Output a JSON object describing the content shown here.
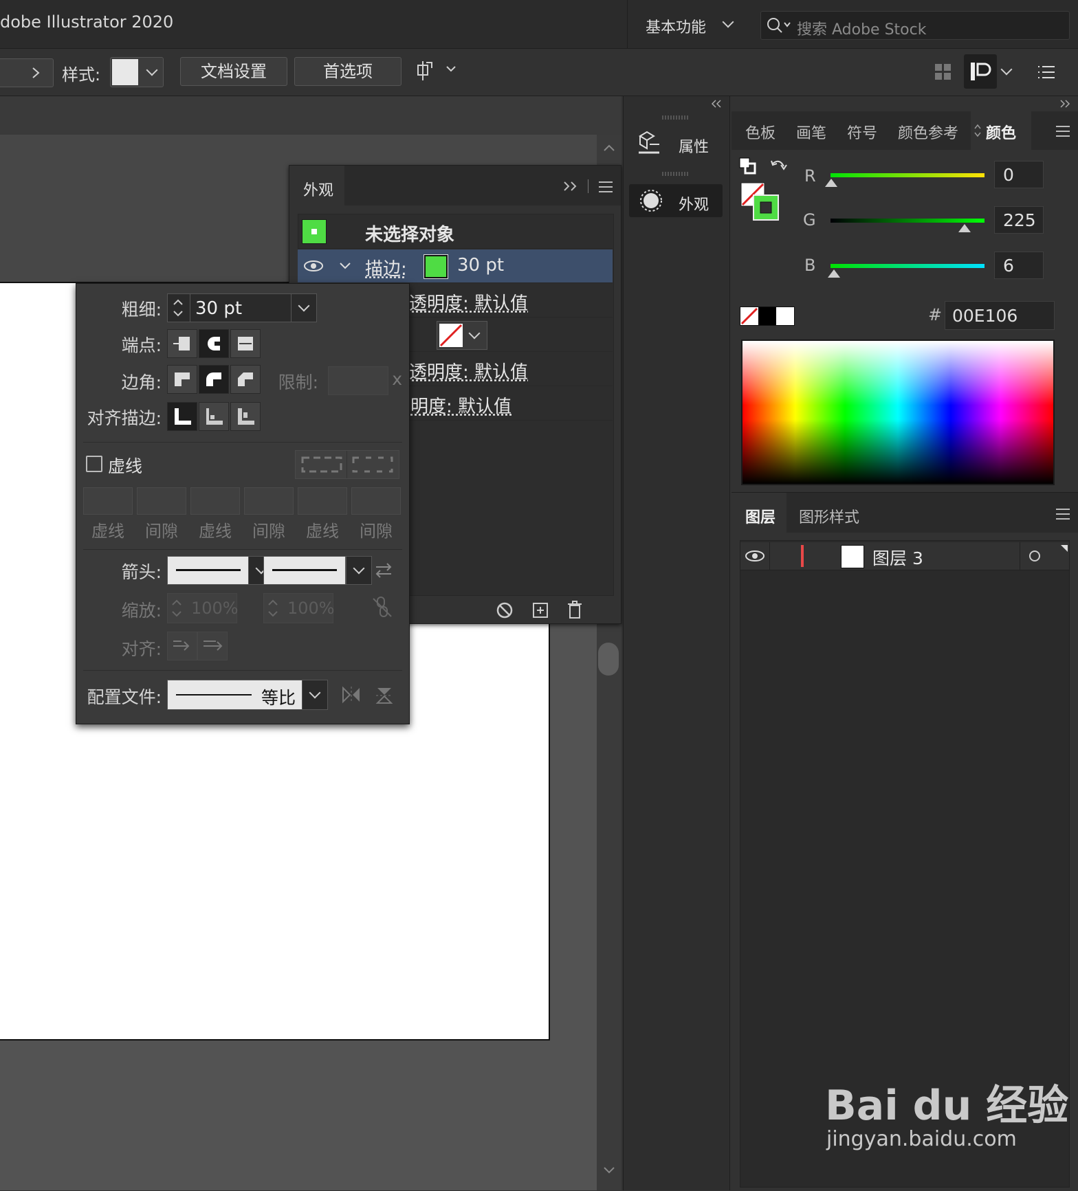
{
  "app": {
    "title": "dobe Illustrator 2020"
  },
  "workspace": {
    "label": "基本功能"
  },
  "search": {
    "placeholder": "搜索 Adobe Stock"
  },
  "controlbar": {
    "style_label": "样式:",
    "doc_setup": "文档设置",
    "preferences": "首选项"
  },
  "appearance": {
    "tab": "外观",
    "no_selection": "未选择对象",
    "stroke_label": "描边:",
    "stroke_value": "30 pt",
    "opacity1": "不透明度: 默认值",
    "opacity2": "不透明度: 默认值",
    "opacity3": "明度: 默认值",
    "stroke_color": "#4fdc44"
  },
  "stroke_panel": {
    "weight_label": "粗细:",
    "weight_value": "30 pt",
    "cap_label": "端点:",
    "corner_label": "边角:",
    "limit_label": "限制:",
    "limit_suffix": "x",
    "align_label": "对齐描边:",
    "dashed_label": "虚线",
    "dash_labels": [
      "虚线",
      "间隙",
      "虚线",
      "间隙",
      "虚线",
      "间隙"
    ],
    "arrow_label": "箭头:",
    "scale_label": "缩放:",
    "scale_value1": "100%",
    "scale_value2": "100%",
    "align2_label": "对齐:",
    "profile_label": "配置文件:",
    "profile_value": "等比"
  },
  "dock": {
    "properties": "属性",
    "appearance": "外观"
  },
  "color_panel": {
    "tabs": [
      "色板",
      "画笔",
      "符号",
      "颜色参考",
      "颜色"
    ],
    "r_label": "R",
    "r_value": "0",
    "g_label": "G",
    "g_value": "225",
    "b_label": "B",
    "b_value": "6",
    "hash": "#",
    "hex": "00E106",
    "accent": "#00E106"
  },
  "layers_panel": {
    "tabs": [
      "图层",
      "图形样式"
    ],
    "layer_name": "图层 3"
  },
  "watermark": {
    "brand": "Bai du 经验",
    "url": "jingyan.baidu.com"
  }
}
